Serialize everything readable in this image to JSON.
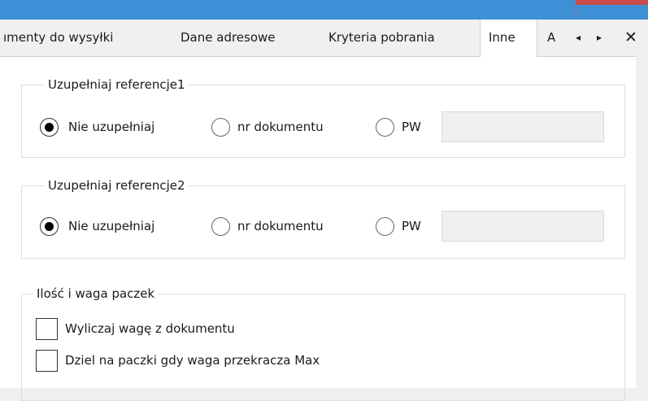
{
  "tabs": [
    {
      "label": "ımenty do wysyłki",
      "active": false
    },
    {
      "label": "Dane adresowe",
      "active": false
    },
    {
      "label": "Kryteria pobrania",
      "active": false
    },
    {
      "label": "Inne",
      "active": true
    },
    {
      "label": "A",
      "active": false,
      "clipped": true
    }
  ],
  "tab_nav": {
    "prev": "◂",
    "next": "▸",
    "close": "✕"
  },
  "ref1": {
    "title": "Uzupełniaj referencje1",
    "options": [
      "Nie uzupełniaj",
      "nr dokumentu",
      "PW"
    ],
    "selected": 0,
    "value": ""
  },
  "ref2": {
    "title": "Uzupełniaj referencje2",
    "options": [
      "Nie uzupełniaj",
      "nr dokumentu",
      "PW"
    ],
    "selected": 0,
    "value": ""
  },
  "packages": {
    "title": "Ilość i waga paczek",
    "checkboxes": [
      {
        "label": "Wyliczaj wagę z dokumentu",
        "checked": false
      },
      {
        "label": "Dziel na paczki gdy waga przekracza Max",
        "checked": false
      }
    ]
  }
}
